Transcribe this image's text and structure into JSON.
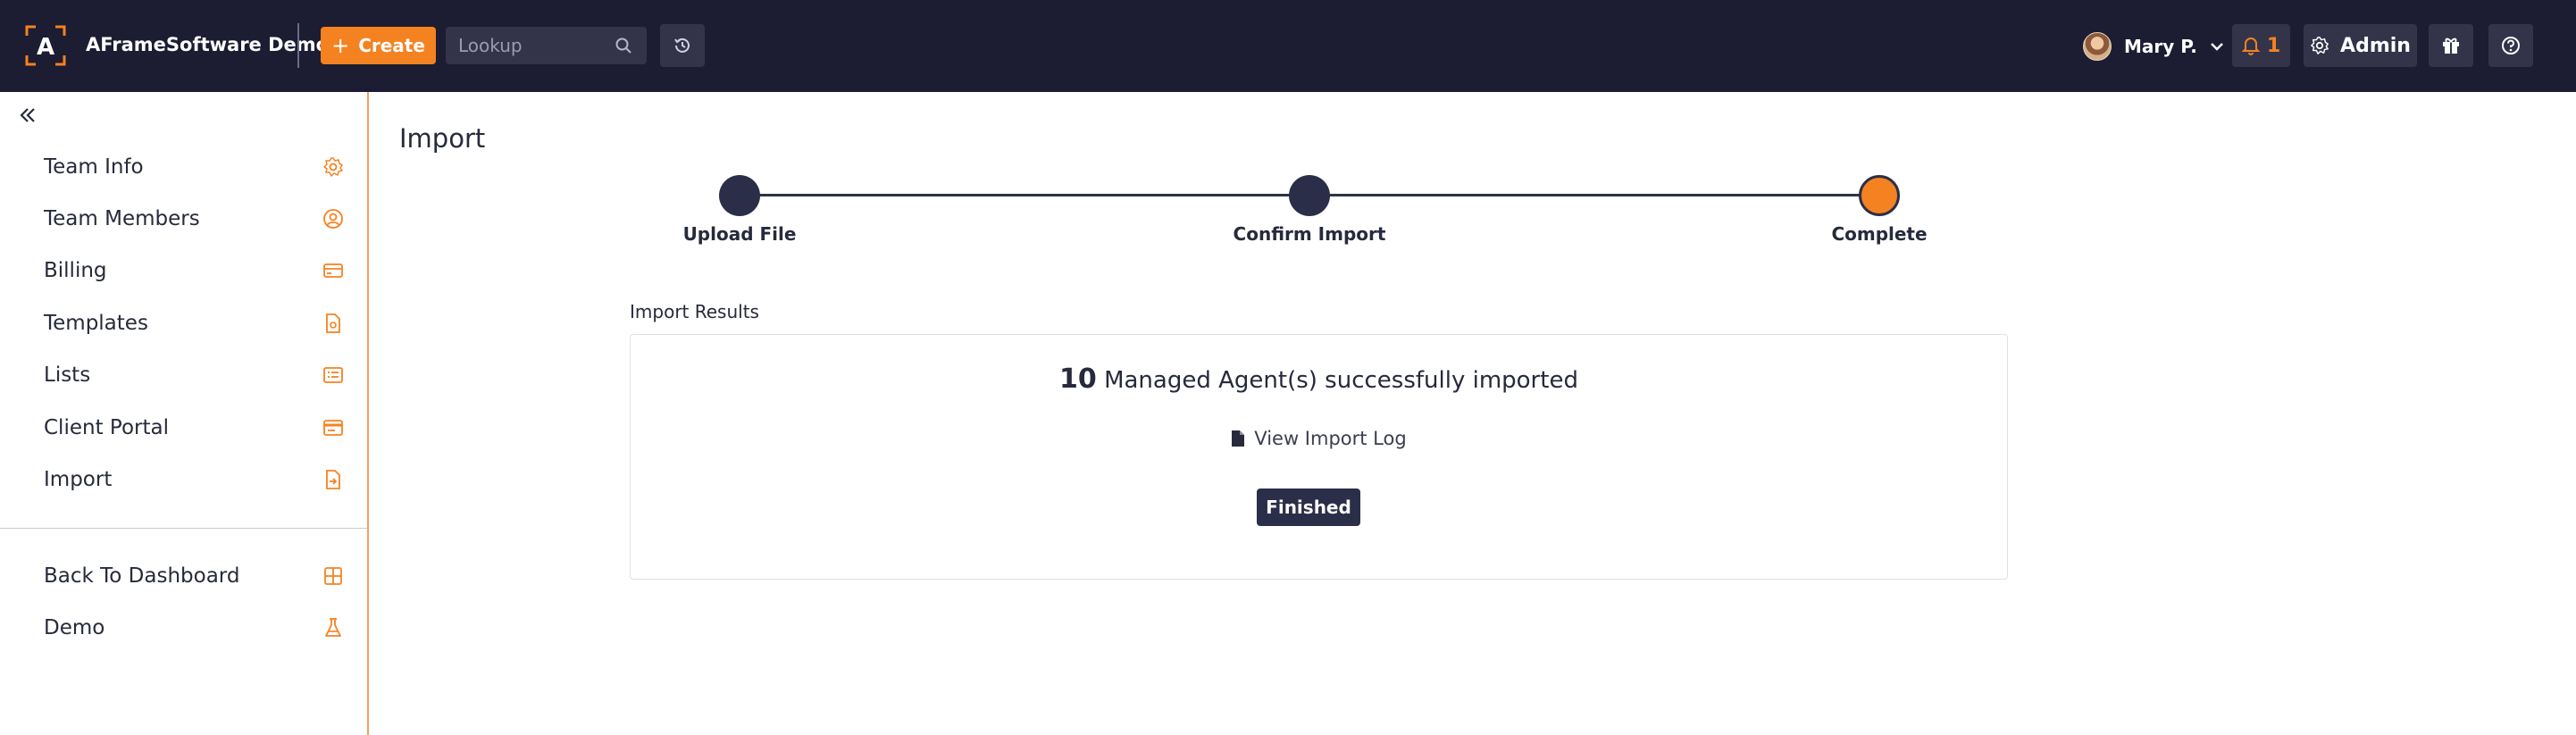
{
  "header": {
    "brand": "AFrameSoftware Demo",
    "logo_letter": "A",
    "create_label": "Create",
    "lookup_placeholder": "Lookup",
    "user_name": "Mary P.",
    "notification_count": "1",
    "admin_label": "Admin"
  },
  "sidebar": {
    "items": [
      {
        "label": "Team Info",
        "icon": "gear-icon"
      },
      {
        "label": "Team Members",
        "icon": "user-circle-icon"
      },
      {
        "label": "Billing",
        "icon": "credit-card-icon"
      },
      {
        "label": "Templates",
        "icon": "document-icon"
      },
      {
        "label": "Lists",
        "icon": "list-icon"
      },
      {
        "label": "Client Portal",
        "icon": "browser-window-icon"
      },
      {
        "label": "Import",
        "icon": "file-import-icon"
      }
    ],
    "bottom_items": [
      {
        "label": "Back To Dashboard",
        "icon": "grid-icon"
      },
      {
        "label": "Demo",
        "icon": "flask-icon"
      }
    ]
  },
  "main": {
    "title": "Import",
    "steps": [
      {
        "label": "Upload File",
        "state": "done"
      },
      {
        "label": "Confirm Import",
        "state": "done"
      },
      {
        "label": "Complete",
        "state": "current"
      }
    ],
    "results_label": "Import Results",
    "result_count": "10",
    "result_text": "Managed Agent(s) successfully imported",
    "log_link": "View Import Log",
    "finished_label": "Finished"
  },
  "colors": {
    "topbar": "#1c1c32",
    "accent": "#f58220",
    "step_dark": "#2b2e48"
  }
}
